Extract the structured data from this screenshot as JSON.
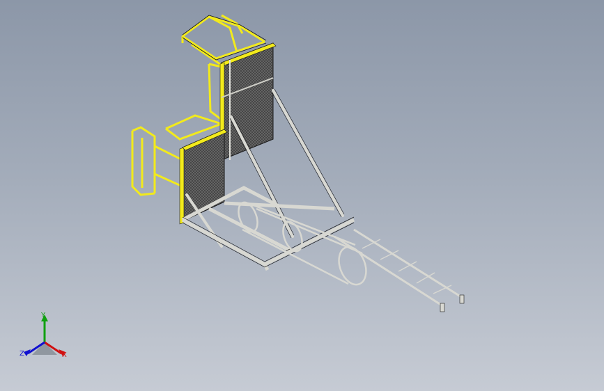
{
  "viewport": {
    "background_top": "#8c97a8",
    "background_bottom": "#c6cbd4"
  },
  "model": {
    "railing_color": "#f2ea1c",
    "steel_color": "#d8d8d2",
    "edge_color": "#1a1a1a",
    "panel_color": "#5a5a5a"
  },
  "triad": {
    "x_label": "X",
    "y_label": "Y",
    "z_label": "Z",
    "x_color": "#d01010",
    "y_color": "#10a010",
    "z_color": "#1010d0"
  }
}
